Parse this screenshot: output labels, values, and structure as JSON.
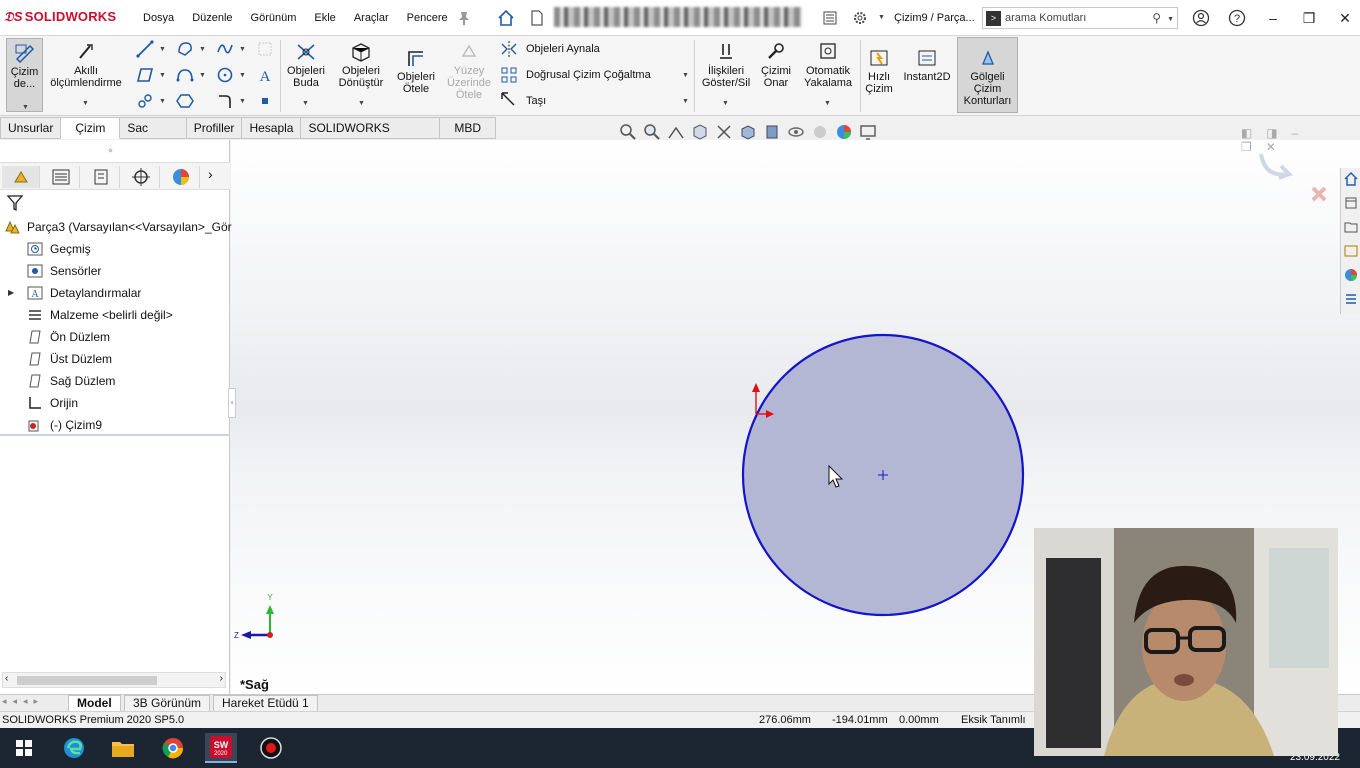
{
  "app": {
    "brand": "SOLIDWORKS",
    "doc_title": "Çizim9 / Parça...",
    "menu": [
      "Dosya",
      "Düzenle",
      "Görünüm",
      "Ekle",
      "Araçlar",
      "Pencere"
    ]
  },
  "search": {
    "placeholder": "arama Komutları"
  },
  "ribbon": {
    "sketch": "Çizim de...",
    "smart_dim": [
      "Akıllı",
      "ölçümlendirme"
    ],
    "trim": [
      "Objeleri",
      "Buda"
    ],
    "convert": [
      "Objeleri",
      "Dönüştür"
    ],
    "offset": [
      "Objeleri",
      "Ötele"
    ],
    "surface_offset": [
      "Yüzey",
      "Üzerinde",
      "Ötele"
    ],
    "mirror": "Objeleri Aynala",
    "linear_pattern": "Doğrusal Çizim Çoğaltma",
    "move": "Taşı",
    "relations": [
      "İlişkileri",
      "Göster/Sil"
    ],
    "repair": [
      "Çizimi",
      "Onar"
    ],
    "quick_snaps": [
      "Otomatik",
      "Yakalama"
    ],
    "rapid_sketch": [
      "Hızlı",
      "Çizim"
    ],
    "instant2d": "Instant2D",
    "shaded_contours": [
      "Gölgeli",
      "Çizim",
      "Konturları"
    ]
  },
  "tabs": [
    "Unsurlar",
    "Çizim",
    "Sac Levha",
    "Profiller",
    "Hesapla",
    "SOLIDWORKS Eklentileri",
    "MBD"
  ],
  "active_tab": "Çizim",
  "tree": {
    "root": "Parça3  (Varsayılan<<Varsayılan>_Gör",
    "items": [
      {
        "label": "Geçmiş",
        "icon": "history-icon"
      },
      {
        "label": "Sensörler",
        "icon": "sensors-icon"
      },
      {
        "label": "Detaylandırmalar",
        "icon": "annotations-icon"
      },
      {
        "label": "Malzeme <belirli değil>",
        "icon": "material-icon"
      },
      {
        "label": "Ön Düzlem",
        "icon": "plane-icon"
      },
      {
        "label": "Üst Düzlem",
        "icon": "plane-icon"
      },
      {
        "label": "Sağ Düzlem",
        "icon": "plane-icon"
      },
      {
        "label": "Orijin",
        "icon": "origin-icon"
      },
      {
        "label": "(-) Çizim9",
        "icon": "sketch-icon"
      }
    ]
  },
  "viewport": {
    "view_name": "*Sağ",
    "triad_y": "Y",
    "triad_z": "Z"
  },
  "bottom_tabs": [
    "Model",
    "3B Görünüm",
    "Hareket Etüdü 1"
  ],
  "status": {
    "product": "SOLIDWORKS Premium 2020 SP5.0",
    "x": "276.06mm",
    "y": "-194.01mm",
    "z": "0.00mm",
    "state": "Eksik Tanımlı"
  },
  "taskbar": {
    "date": "23.09.2022",
    "sw_badge": "2020"
  },
  "colors": {
    "accent": "#c8102e",
    "sketch_fill": "#b4b7d4",
    "sketch_stroke": "#1414c8"
  }
}
